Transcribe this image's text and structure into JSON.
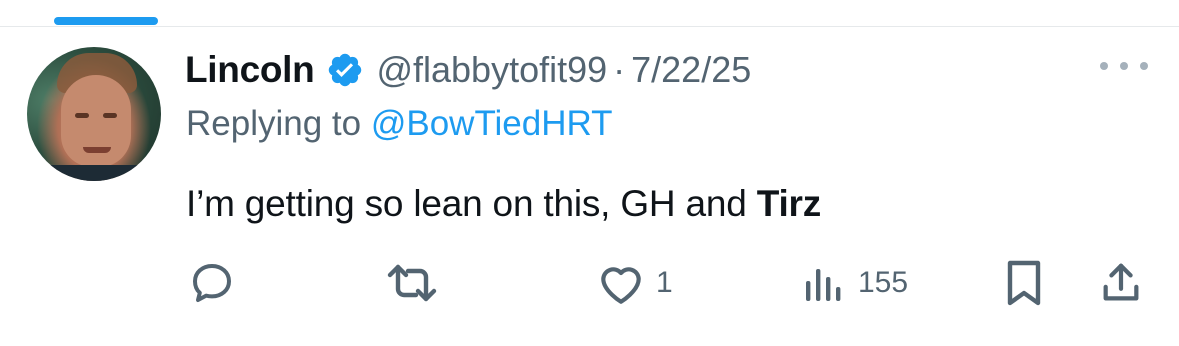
{
  "author": {
    "name": "Lincoln",
    "handle": "@flabbytofit99",
    "separator": "·",
    "date": "7/22/25",
    "verified_color": "#1d9bf0"
  },
  "reply": {
    "prefix": "Replying to ",
    "to_handle": "@BowTiedHRT"
  },
  "tweet": {
    "text_plain": "I’m getting so lean on this, GH and ",
    "text_bold": "Tirz"
  },
  "actions": {
    "reply_icon": "comment-icon",
    "retweet_icon": "retweet-icon",
    "like_icon": "heart-icon",
    "like_count": "1",
    "views_icon": "views-chart-icon",
    "views_count": "155",
    "bookmark_icon": "bookmark-icon",
    "share_icon": "share-icon"
  },
  "colors": {
    "accent": "#1d9bf0",
    "secondary_text": "#536471"
  }
}
